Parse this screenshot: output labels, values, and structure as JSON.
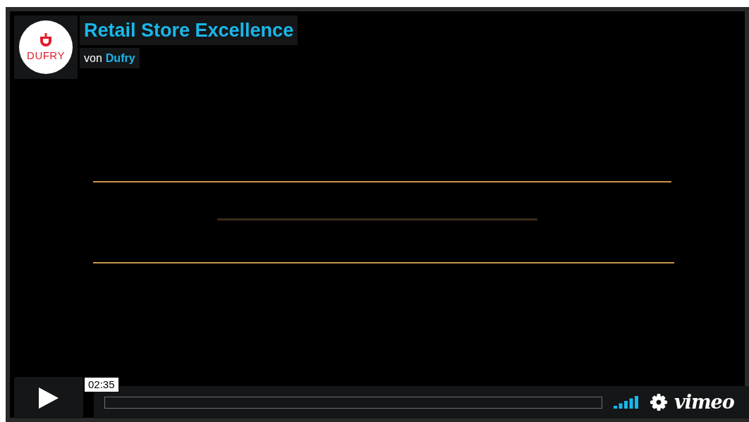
{
  "channel": {
    "logo_text": "DUFRY",
    "title": "Retail Store Excellence",
    "byline_prefix": "von",
    "author": "Dufry"
  },
  "controls": {
    "time": "02:35",
    "progress": {
      "level": 0
    },
    "brand": "vimeo"
  }
}
